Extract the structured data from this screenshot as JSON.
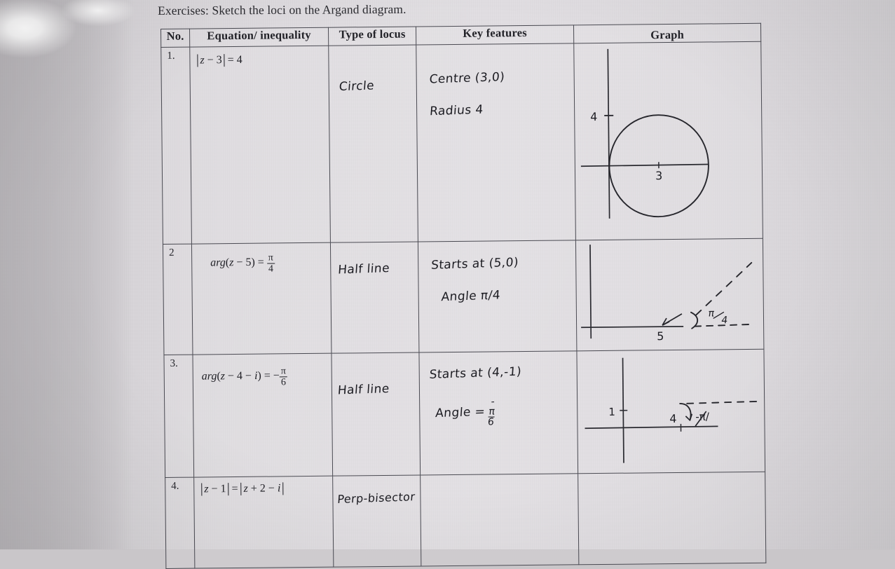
{
  "heading": "Exercises: Sketch the loci on the Argand diagram.",
  "table": {
    "headers": [
      "No.",
      "Equation/ inequality",
      "Type of locus",
      "Key features",
      "Graph"
    ],
    "rows": [
      {
        "no": "1.",
        "equation_plain": "|z - 3| = 4",
        "equation": {
          "lhs_var": "z",
          "lhs_op": "−",
          "lhs_num": "3",
          "eq": "=",
          "rhs": "4"
        },
        "type_of_locus": "Circle",
        "key_features": [
          "Centre (3,0)",
          "Radius 4"
        ],
        "graph": {
          "kind": "circle",
          "centre_label": "3",
          "y_tick_label": "4",
          "centre": [
            3,
            0
          ],
          "radius": 4
        }
      },
      {
        "no": "2",
        "equation_plain": "arg(z - 5) = π/4",
        "equation": {
          "fn": "arg",
          "var": "z",
          "op": "−",
          "num": "5",
          "eq": "=",
          "frac_num": "π",
          "frac_den": "4"
        },
        "type_of_locus": "Half line",
        "key_features": [
          "Starts at (5,0)",
          "Angle π/4"
        ],
        "graph": {
          "kind": "half-line",
          "start_label": "5",
          "angle_label_num": "π",
          "angle_label_den": "4",
          "start_point": [
            5,
            0
          ],
          "angle_deg": 45
        }
      },
      {
        "no": "3.",
        "equation_plain": "arg(z - 4 - i) = -π/6",
        "equation": {
          "fn": "arg",
          "var": "z",
          "op": "−",
          "num": "4",
          "op2": "−",
          "imag": "i",
          "eq": "=",
          "sign": "−",
          "frac_num": "π",
          "frac_den": "6"
        },
        "type_of_locus": "Half line",
        "key_features": [
          "Starts at (4,-1)",
          "Angle = -π/6"
        ],
        "key_features_frac": {
          "label": "Angle =",
          "sign": "-",
          "num": "π",
          "den": "6"
        },
        "graph": {
          "kind": "half-line",
          "x_label": "4",
          "y_label": "1",
          "angle_label": "-π/",
          "start_point": [
            4,
            -1
          ],
          "angle_deg": -30
        }
      },
      {
        "no": "4.",
        "equation_plain": "|z - 1| = |z + 2 - i|",
        "equation": {
          "lhs_var": "z",
          "lhs_op": "−",
          "lhs_num": "1",
          "eq": "=",
          "rhs_var": "z",
          "rhs_op": "+",
          "rhs_num": "2",
          "rhs_op2": "−",
          "rhs_imag": "i"
        },
        "type_of_locus": "Perp-bisector",
        "key_features": [],
        "graph": {
          "kind": "empty"
        }
      }
    ]
  }
}
